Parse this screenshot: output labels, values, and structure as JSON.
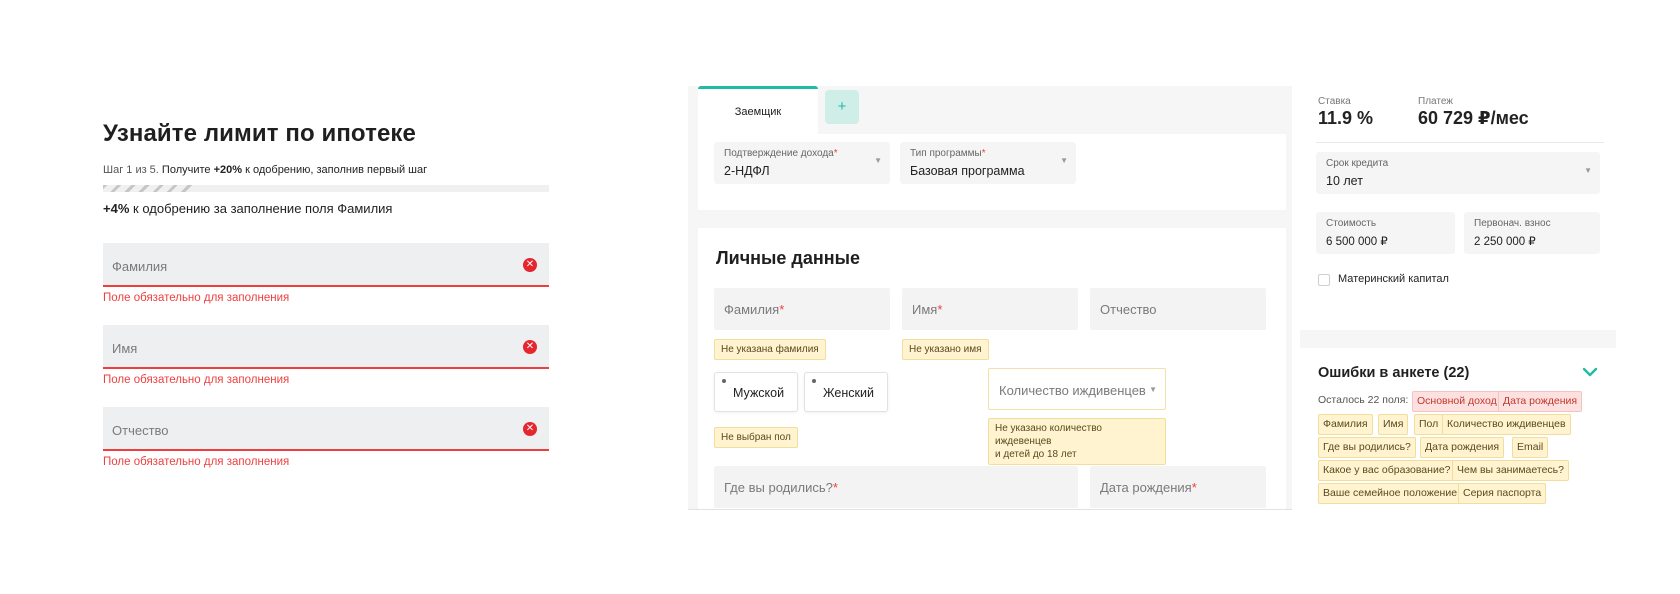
{
  "left": {
    "title": "Узнайте лимит по ипотеке",
    "step": {
      "prefix": "Шаг 1 из 5.",
      "get": "Получите",
      "bonus": "+20%",
      "rest": "к одобрению, заполнив первый шаг"
    },
    "progress_fraction": 0.2,
    "field_bonus": {
      "value": "+4%",
      "text": "к одобрению за заполнение поля Фамилия"
    },
    "fields": [
      {
        "placeholder": "Фамилия",
        "error": "Поле обязательно для заполнения"
      },
      {
        "placeholder": "Имя",
        "error": "Поле обязательно для заполнения"
      },
      {
        "placeholder": "Отчество",
        "error": "Поле обязательно для заполнения"
      }
    ],
    "clear_glyph": "✕"
  },
  "center": {
    "tabs": {
      "active": "Заемщик",
      "add": "+"
    },
    "income": {
      "label": "Подтверждение дохода",
      "required": "*",
      "value": "2-НДФЛ"
    },
    "program": {
      "label": "Тип программы",
      "required": "*",
      "value": "Базовая программа"
    },
    "section_title": "Личные данные",
    "surname": {
      "placeholder": "Фамилия",
      "required": "*",
      "warning": "Не указана фамилия"
    },
    "name": {
      "placeholder": "Имя",
      "required": "*",
      "warning": "Не указано имя"
    },
    "patronymic": {
      "placeholder": "Отчество"
    },
    "gender": {
      "male": "Мужской",
      "female": "Женский",
      "warning": "Не выбран пол"
    },
    "dependents": {
      "placeholder": "Количество иждивенцев",
      "warning_line1": "Не указано количество иждевенцев",
      "warning_line2": "и детей до 18 лет"
    },
    "birthplace": {
      "placeholder": "Где вы родились?",
      "required": "*"
    },
    "birthdate": {
      "placeholder": "Дата рождения",
      "required": "*"
    },
    "arrow_glyph": "▼"
  },
  "right": {
    "rate": {
      "label": "Ставка",
      "value": "11.9 %"
    },
    "payment": {
      "label": "Платеж",
      "value": "60 729 ₽/мес"
    },
    "term": {
      "label": "Срок кредита",
      "value": "10 лет"
    },
    "cost": {
      "label": "Стоимость",
      "value": "6 500 000 ₽"
    },
    "down_payment": {
      "label": "Первонач. взнос",
      "value": "2 250 000 ₽"
    },
    "maternity_capital": "Материнский капитал",
    "errors": {
      "title": "Ошибки в анкете (22)",
      "remaining": "Осталось 22 поля:",
      "chips": [
        "Основной доход",
        "Дата рождения",
        "Фамилия",
        "Имя",
        "Пол",
        "Количество иждивенцев",
        "Где вы родились?",
        "Дата рождения",
        "Email",
        "Какое у вас образование?",
        "Чем вы занимаетесь?",
        "Ваше семейное положение",
        "Серия паспорта"
      ]
    }
  },
  "colors": {
    "accent": "#1fbba6",
    "error": "#ee3f3f",
    "warning_bg": "#fff4cf",
    "error_chip_bg": "#fde1e1"
  }
}
